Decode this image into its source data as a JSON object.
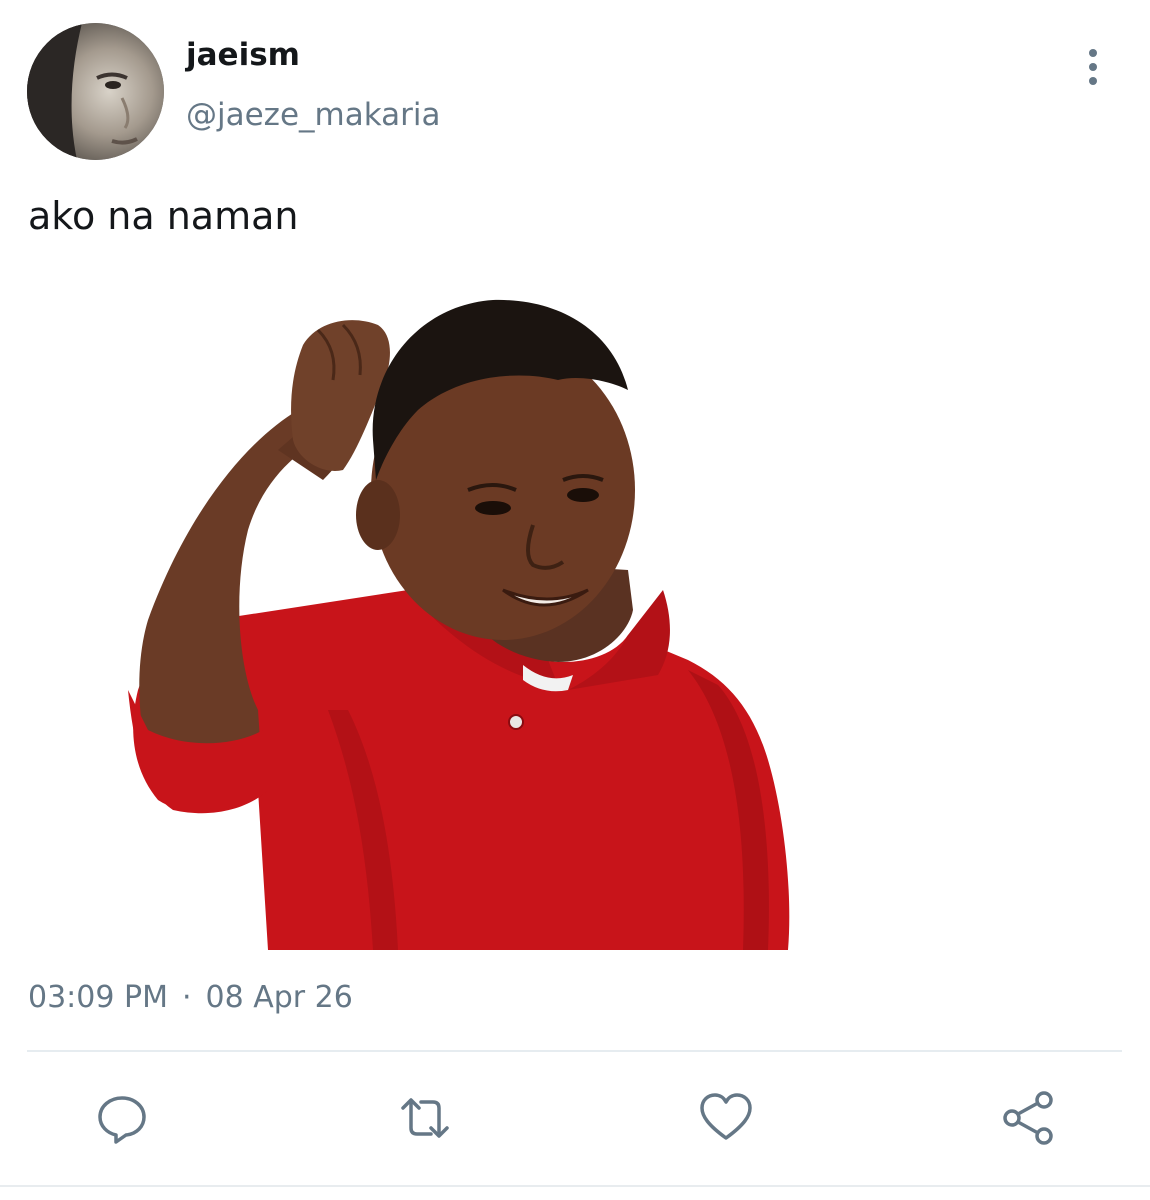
{
  "tweet": {
    "display_name": "jaeism",
    "handle": "@jaeze_makaria",
    "text": "ako na naman",
    "time": "03:09 PM",
    "separator": "·",
    "date": "08 Apr 26"
  },
  "icons": {
    "more": "more-vertical-icon",
    "reply": "reply-icon",
    "retweet": "retweet-icon",
    "like": "heart-icon",
    "share": "share-icon"
  },
  "colors": {
    "name": "#14171a",
    "secondary": "#657786",
    "icon": "#657786",
    "divider": "#e6ecf0",
    "shirt": "#c8141a"
  }
}
